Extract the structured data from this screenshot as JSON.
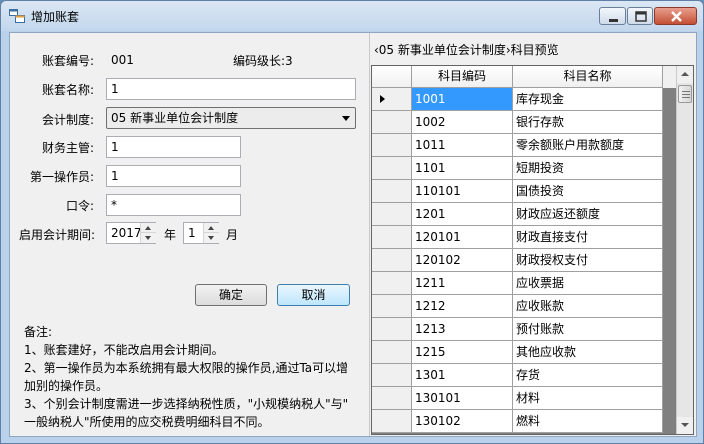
{
  "window": {
    "title": "增加账套",
    "accent": "#3399ff"
  },
  "form": {
    "account_no_label": "账套编号:",
    "account_no_value": "001",
    "code_level_label": "编码级长:3",
    "account_name_label": "账套名称:",
    "account_name_value": "1",
    "accounting_system_label": "会计制度:",
    "accounting_system_value": "05 新事业单位会计制度",
    "finance_manager_label": "财务主管:",
    "finance_manager_value": "1",
    "first_operator_label": "第一操作员:",
    "first_operator_value": "1",
    "password_label": "口令:",
    "password_value": "*",
    "start_period_label": "启用会计期间:",
    "year_value": "2017",
    "year_unit": "年",
    "month_value": "1",
    "month_unit": "月",
    "ok_button": "确定",
    "cancel_button": "取消"
  },
  "notes": {
    "title": "备注:",
    "lines": [
      "1、账套建好，不能改启用会计期间。",
      "2、第一操作员为本系统拥有最大权限的操作员,通过Ta可以增",
      "加别的操作员。",
      "3、个别会计制度需进一步选择纳税性质，\"小规模纳税人\"与\"",
      "一般纳税人\"所使用的应交税费明细科目不同。"
    ]
  },
  "preview": {
    "title": "‹05 新事业单位会计制度›科目预览",
    "columns": [
      "科目编码",
      "科目名称"
    ],
    "rows": [
      {
        "code": "1001",
        "name": "库存现金"
      },
      {
        "code": "1002",
        "name": "银行存款"
      },
      {
        "code": "1011",
        "name": "零余额账户用款额度"
      },
      {
        "code": "1101",
        "name": "短期投资"
      },
      {
        "code": "110101",
        "name": "国债投资"
      },
      {
        "code": "1201",
        "name": "财政应返还额度"
      },
      {
        "code": "120101",
        "name": "财政直接支付"
      },
      {
        "code": "120102",
        "name": "财政授权支付"
      },
      {
        "code": "1211",
        "name": "应收票据"
      },
      {
        "code": "1212",
        "name": "应收账款"
      },
      {
        "code": "1213",
        "name": "预付账款"
      },
      {
        "code": "1215",
        "name": "其他应收款"
      },
      {
        "code": "1301",
        "name": "存货"
      },
      {
        "code": "130101",
        "name": "材料"
      },
      {
        "code": "130102",
        "name": "燃料"
      }
    ]
  }
}
